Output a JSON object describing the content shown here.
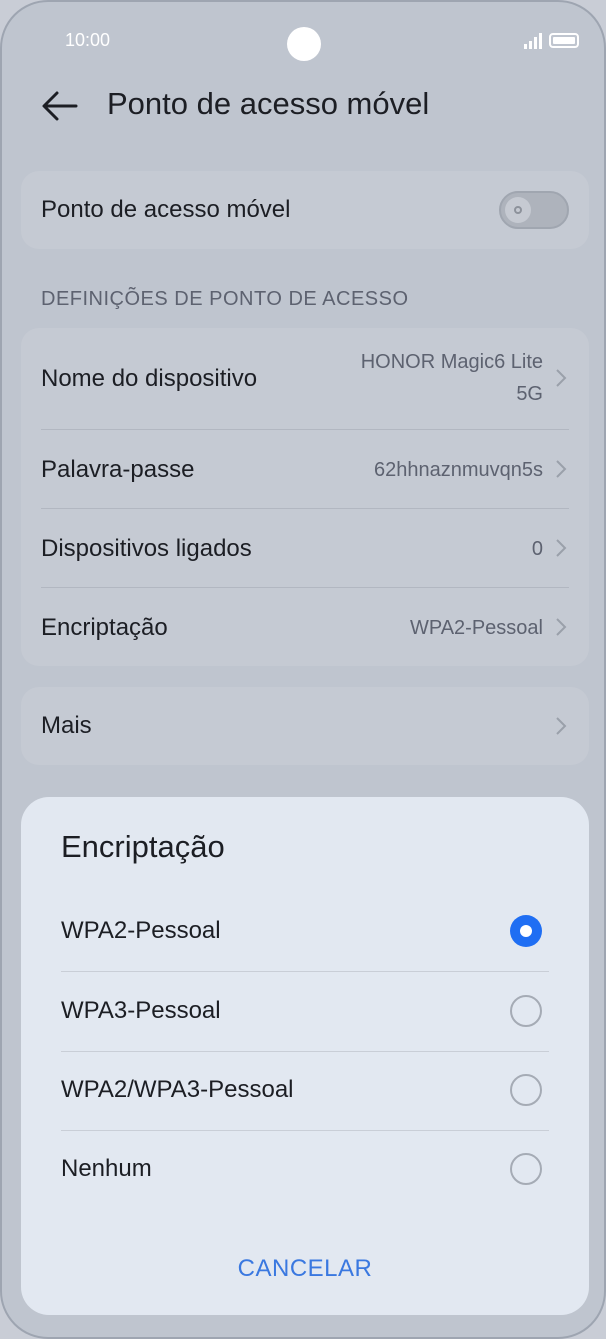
{
  "status_bar": {
    "time": "10:00"
  },
  "header": {
    "title": "Ponto de acesso móvel"
  },
  "hotspot": {
    "label": "Ponto de acesso móvel",
    "enabled": false
  },
  "settings": {
    "section_title": "DEFINIÇÕES DE PONTO DE ACESSO",
    "device_name": {
      "label": "Nome do dispositivo",
      "value_line1": "HONOR Magic6 Lite",
      "value_line2": "5G"
    },
    "password": {
      "label": "Palavra-passe",
      "value": "62hhnaznmuvqn5s"
    },
    "connected_devices": {
      "label": "Dispositivos ligados",
      "value": "0"
    },
    "encryption": {
      "label": "Encriptação",
      "value": "WPA2-Pessoal"
    }
  },
  "more": {
    "label": "Mais"
  },
  "dialog": {
    "title": "Encriptação",
    "options": [
      {
        "label": "WPA2-Pessoal",
        "selected": true
      },
      {
        "label": "WPA3-Pessoal",
        "selected": false
      },
      {
        "label": "WPA2/WPA3-Pessoal",
        "selected": false
      },
      {
        "label": "Nenhum",
        "selected": false
      }
    ],
    "cancel_label": "CANCELAR"
  },
  "colors": {
    "accent": "#1f6ef3",
    "cancel": "#3a78e0"
  }
}
